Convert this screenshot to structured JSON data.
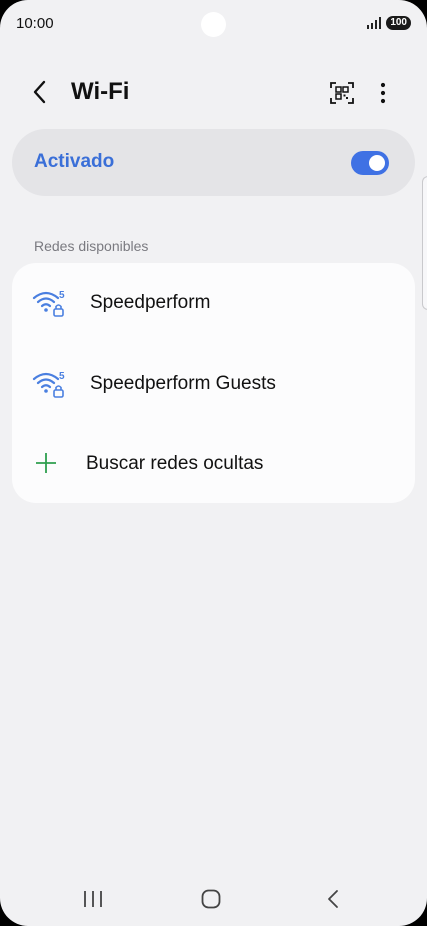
{
  "status_bar": {
    "time": "10:00",
    "battery": "100"
  },
  "header": {
    "title": "Wi-Fi"
  },
  "master": {
    "label": "Activado",
    "enabled": true
  },
  "section": {
    "title": "Redes disponibles"
  },
  "networks": [
    {
      "name": "Speedperform",
      "band": "5",
      "secured": true
    },
    {
      "name": "Speedperform Guests",
      "band": "5",
      "secured": true
    }
  ],
  "hidden_search": {
    "label": "Buscar redes ocultas"
  },
  "icons": {
    "back": "chevron-left-icon",
    "qr": "qr-code-icon",
    "more": "more-vertical-icon",
    "wifi": "wifi-lock-icon",
    "plus": "plus-icon"
  },
  "colors": {
    "accent": "#3a6fd8",
    "toggle": "#3f71e4",
    "plus": "#2e9e4e",
    "wifi_icon": "#4a7fe0"
  }
}
